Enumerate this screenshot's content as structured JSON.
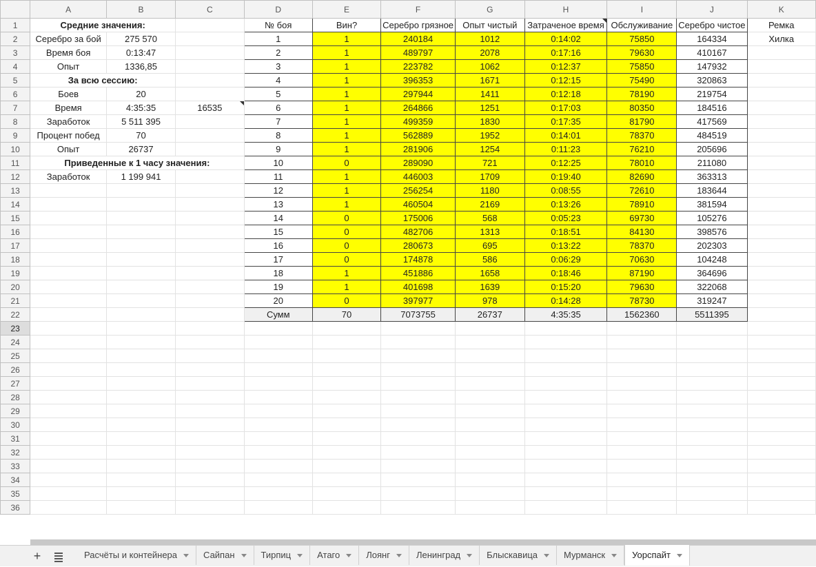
{
  "columns": [
    "A",
    "B",
    "C",
    "D",
    "E",
    "F",
    "G",
    "H",
    "I",
    "J",
    "K"
  ],
  "selected_row": "23",
  "left_panel": {
    "avg_title": "Средние значения:",
    "silver_per_battle_label": "Серебро за бой",
    "silver_per_battle": "275 570",
    "battle_time_label": "Время боя",
    "battle_time": "0:13:47",
    "exp_label": "Опыт",
    "exp": "1336,85",
    "session_title": "За всю сессию:",
    "battles_label": "Боев",
    "battles": "20",
    "time_label": "Время",
    "time": "4:35:35",
    "time_seconds": "16535",
    "earnings_label": "Заработок",
    "earnings": "5 511 395",
    "winrate_label": "Процент побед",
    "winrate": "70",
    "session_exp_label": "Опыт",
    "session_exp": "26737",
    "hourly_title": "Приведенные к 1 часу значения:",
    "hourly_earnings_label": "Заработок",
    "hourly_earnings": "1 199 941"
  },
  "table": {
    "headers": [
      "№ боя",
      "Вин?",
      "Серебро грязное",
      "Опыт чистый",
      "Затраченое время",
      "Обслуживание",
      "Серебро чистое"
    ],
    "rows": [
      [
        "1",
        "1",
        "240184",
        "1012",
        "0:14:02",
        "75850",
        "164334"
      ],
      [
        "2",
        "1",
        "489797",
        "2078",
        "0:17:16",
        "79630",
        "410167"
      ],
      [
        "3",
        "1",
        "223782",
        "1062",
        "0:12:37",
        "75850",
        "147932"
      ],
      [
        "4",
        "1",
        "396353",
        "1671",
        "0:12:15",
        "75490",
        "320863"
      ],
      [
        "5",
        "1",
        "297944",
        "1411",
        "0:12:18",
        "78190",
        "219754"
      ],
      [
        "6",
        "1",
        "264866",
        "1251",
        "0:17:03",
        "80350",
        "184516"
      ],
      [
        "7",
        "1",
        "499359",
        "1830",
        "0:17:35",
        "81790",
        "417569"
      ],
      [
        "8",
        "1",
        "562889",
        "1952",
        "0:14:01",
        "78370",
        "484519"
      ],
      [
        "9",
        "1",
        "281906",
        "1254",
        "0:11:23",
        "76210",
        "205696"
      ],
      [
        "10",
        "0",
        "289090",
        "721",
        "0:12:25",
        "78010",
        "211080"
      ],
      [
        "11",
        "1",
        "446003",
        "1709",
        "0:19:40",
        "82690",
        "363313"
      ],
      [
        "12",
        "1",
        "256254",
        "1180",
        "0:08:55",
        "72610",
        "183644"
      ],
      [
        "13",
        "1",
        "460504",
        "2169",
        "0:13:26",
        "78910",
        "381594"
      ],
      [
        "14",
        "0",
        "175006",
        "568",
        "0:05:23",
        "69730",
        "105276"
      ],
      [
        "15",
        "0",
        "482706",
        "1313",
        "0:18:51",
        "84130",
        "398576"
      ],
      [
        "16",
        "0",
        "280673",
        "695",
        "0:13:22",
        "78370",
        "202303"
      ],
      [
        "17",
        "0",
        "174878",
        "586",
        "0:06:29",
        "70630",
        "104248"
      ],
      [
        "18",
        "1",
        "451886",
        "1658",
        "0:18:46",
        "87190",
        "364696"
      ],
      [
        "19",
        "1",
        "401698",
        "1639",
        "0:15:20",
        "79630",
        "322068"
      ],
      [
        "20",
        "0",
        "397977",
        "978",
        "0:14:28",
        "78730",
        "319247"
      ]
    ],
    "sum_row": [
      "Сумм",
      "70",
      "7073755",
      "26737",
      "4:35:35",
      "1562360",
      "5511395"
    ]
  },
  "side_notes": [
    "Ремка",
    "Хилка"
  ],
  "sheet_tabs": [
    "Расчёты и контейнера",
    "Сайпан",
    "Тирпиц",
    "Атаго",
    "Лоянг",
    "Ленинград",
    "Блыскавица",
    "Мурманск",
    "Уорспайт"
  ],
  "active_tab": "Уорспайт",
  "colors": {
    "highlight": "#ffff00",
    "header_bg": "#f3f3f3",
    "sum_bg": "#f0f0f0"
  }
}
